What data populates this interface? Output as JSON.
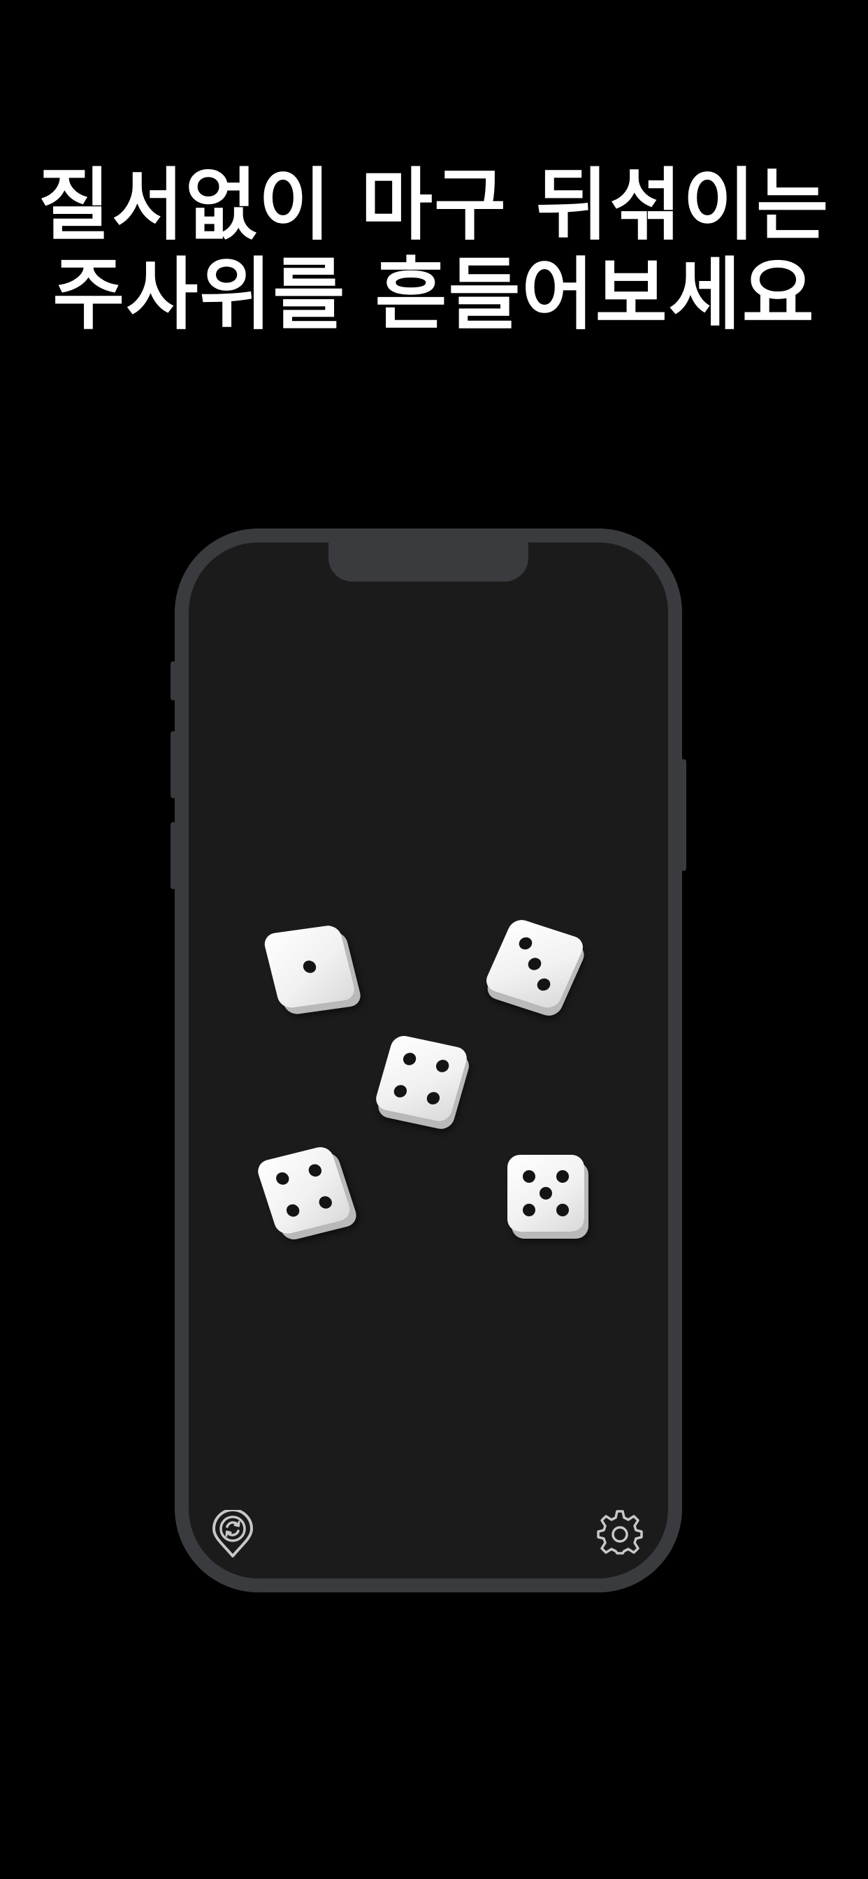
{
  "headline": {
    "line1": "질서없이 마구 뒤섞이는",
    "line2": "주사위를 흔들어보세요"
  },
  "dice": [
    {
      "name": "die-1",
      "value": 1
    },
    {
      "name": "die-2",
      "value": 3
    },
    {
      "name": "die-3",
      "value": 4
    },
    {
      "name": "die-4",
      "value": 4
    },
    {
      "name": "die-5",
      "value": 5
    }
  ],
  "toolbar": {
    "left_icon": "location-refresh-icon",
    "right_icon": "gear-icon"
  },
  "colors": {
    "background": "#000000",
    "phone_frame": "#3a3b3f",
    "screen": "#1b1b1b",
    "die_face": "#ffffff",
    "pip": "#141414",
    "icon": "#c8c8c8"
  }
}
